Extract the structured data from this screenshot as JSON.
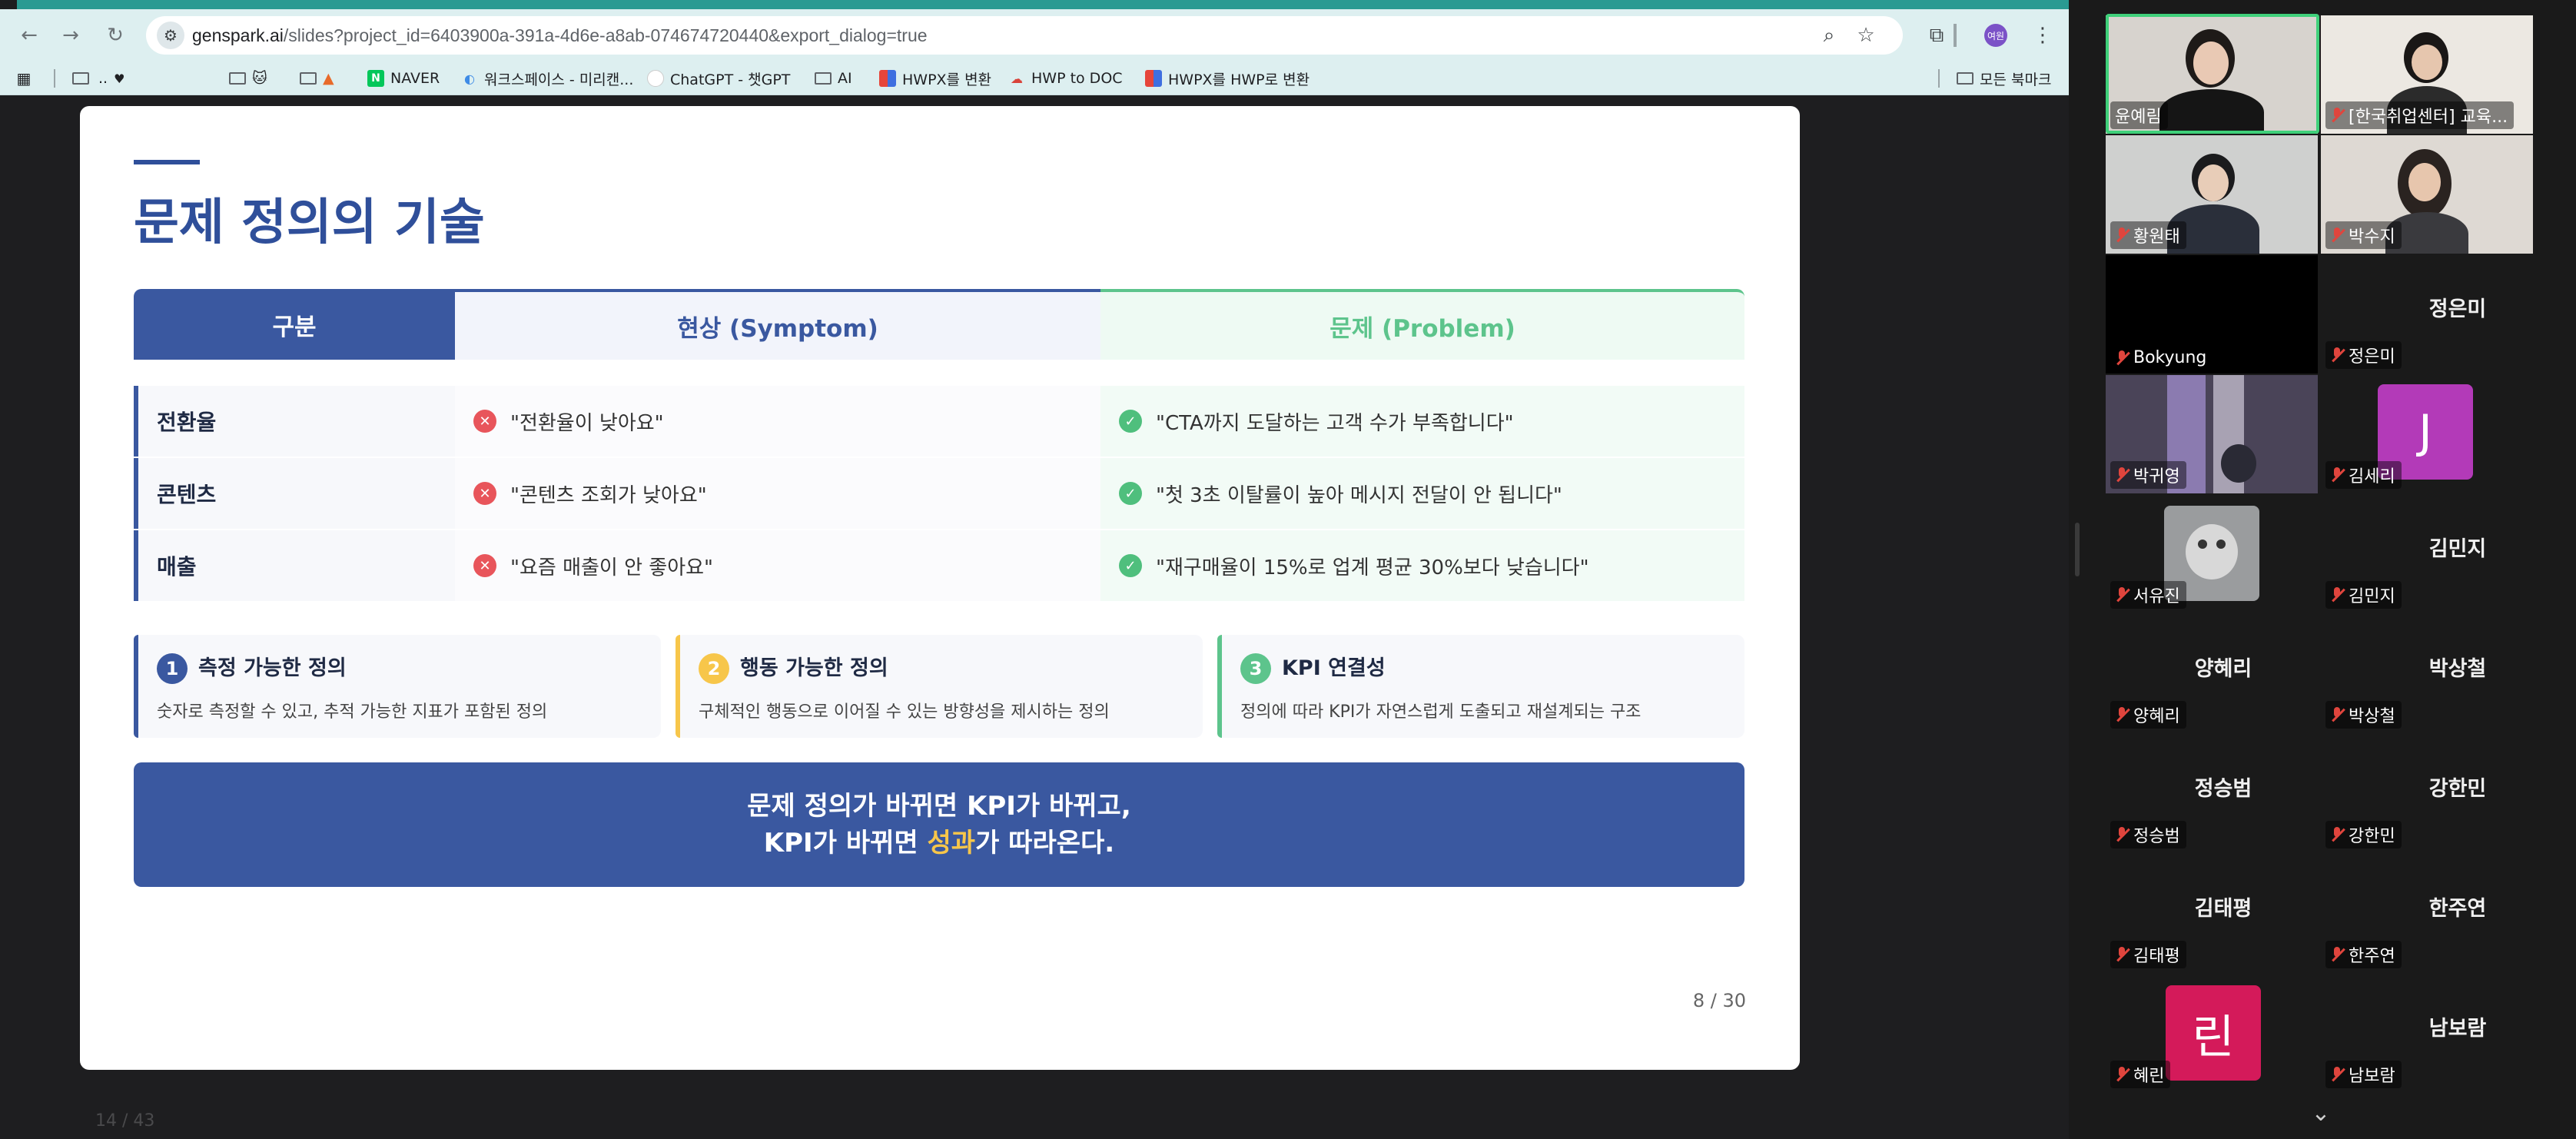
{
  "browser": {
    "url_host": "genspark.ai",
    "url_path": "/slides?project_id=6403900a-391a-4d6e-a8ab-074674720440&export_dialog=true",
    "profile_initials": "여원",
    "bookmarks": [
      {
        "label": "",
        "icon": "folder-icon"
      },
      {
        "label": "..",
        "icon": "folder-icon"
      },
      {
        "label": "🐱",
        "icon": "folder-icon"
      },
      {
        "label": "",
        "icon": "folder-icon"
      },
      {
        "label": "NAVER",
        "icon": "naver-icon"
      },
      {
        "label": "워크스페이스 - 미리캔...",
        "icon": "miricanvas-icon"
      },
      {
        "label": "ChatGPT - 챗GPT",
        "icon": "chatgpt-icon"
      },
      {
        "label": "AI",
        "icon": "folder-icon"
      },
      {
        "label": "HWPX를 변환",
        "icon": "hwpx-icon"
      },
      {
        "label": "HWP to DOC",
        "icon": "hwp-icon"
      },
      {
        "label": "HWPX를 HWP로 변환",
        "icon": "hwpx-icon"
      },
      {
        "label": "모든 북마크",
        "icon": "folder-icon"
      }
    ]
  },
  "slide": {
    "title": "문제 정의의 기술",
    "table": {
      "headers": [
        "구분",
        "현상 (Symptom)",
        "문제 (Problem)"
      ],
      "rows": [
        {
          "category": "전환율",
          "symptom": "\"전환율이 낮아요\"",
          "problem": "\"CTA까지 도달하는 고객 수가 부족합니다\""
        },
        {
          "category": "콘텐츠",
          "symptom": "\"콘텐츠 조회가 낮아요\"",
          "problem": "\"첫 3초 이탈률이 높아 메시지 전달이 안 됩니다\""
        },
        {
          "category": "매출",
          "symptom": "\"요즘 매출이 안 좋아요\"",
          "problem": "\"재구매율이 15%로 업계 평균 30%보다 낮습니다\""
        }
      ]
    },
    "cards": [
      {
        "num": "1",
        "title": "측정 가능한 정의",
        "desc": "숫자로 측정할 수 있고, 추적 가능한 지표가 포함된 정의",
        "color": "#3a58a0"
      },
      {
        "num": "2",
        "title": "행동 가능한 정의",
        "desc": "구체적인 행동으로 이어질 수 있는 방향성을 제시하는 정의",
        "color": "#f7c64a"
      },
      {
        "num": "3",
        "title": "KPI 연결성",
        "desc": "정의에 따라 KPI가 자연스럽게 도출되고 재설계되는 구조",
        "color": "#5dc48c"
      }
    ],
    "banner": {
      "line1": "문제 정의가 바뀌면 KPI가 바뀌고,",
      "line2_prefix": "KPI가 바뀌면 ",
      "line2_highlight": "성과",
      "line2_suffix": "가 따라온다."
    },
    "page": "8 / 30"
  },
  "viewer_counter": "14 / 43",
  "participants": [
    {
      "name": "윤예림",
      "kind": "video",
      "muted": false,
      "active": true
    },
    {
      "name": "[한국취업센터] 교육...",
      "kind": "video",
      "muted": true,
      "active": false
    },
    {
      "name": "황원태",
      "kind": "video",
      "muted": true,
      "active": false
    },
    {
      "name": "박수지",
      "kind": "video",
      "muted": true,
      "active": false
    },
    {
      "name": "Bokyung",
      "kind": "black",
      "muted": true,
      "active": false
    },
    {
      "name": "정은미",
      "kind": "name",
      "muted": true,
      "active": false
    },
    {
      "name": "박귀영",
      "kind": "video",
      "muted": true,
      "active": false
    },
    {
      "name": "김세리",
      "kind": "avatar",
      "avatar_letter": "J",
      "avatar_color": "#b33ab8",
      "muted": true,
      "active": false
    },
    {
      "name": "서유진",
      "kind": "photo",
      "muted": true,
      "active": false
    },
    {
      "name": "김민지",
      "kind": "name",
      "muted": true,
      "active": false
    },
    {
      "name": "양혜리",
      "kind": "name",
      "muted": true,
      "active": false
    },
    {
      "name": "박상철",
      "kind": "name",
      "muted": true,
      "active": false
    },
    {
      "name": "정승범",
      "kind": "name",
      "muted": true,
      "active": false
    },
    {
      "name": "강한민",
      "kind": "name",
      "muted": true,
      "active": false
    },
    {
      "name": "김태평",
      "kind": "name",
      "muted": true,
      "active": false
    },
    {
      "name": "한주연",
      "kind": "name",
      "muted": true,
      "active": false
    },
    {
      "name": "혜린",
      "kind": "avatar",
      "avatar_letter": "린",
      "avatar_color": "#d41a5a",
      "muted": true,
      "active": false
    },
    {
      "name": "남보람",
      "kind": "name",
      "muted": true,
      "active": false
    }
  ]
}
